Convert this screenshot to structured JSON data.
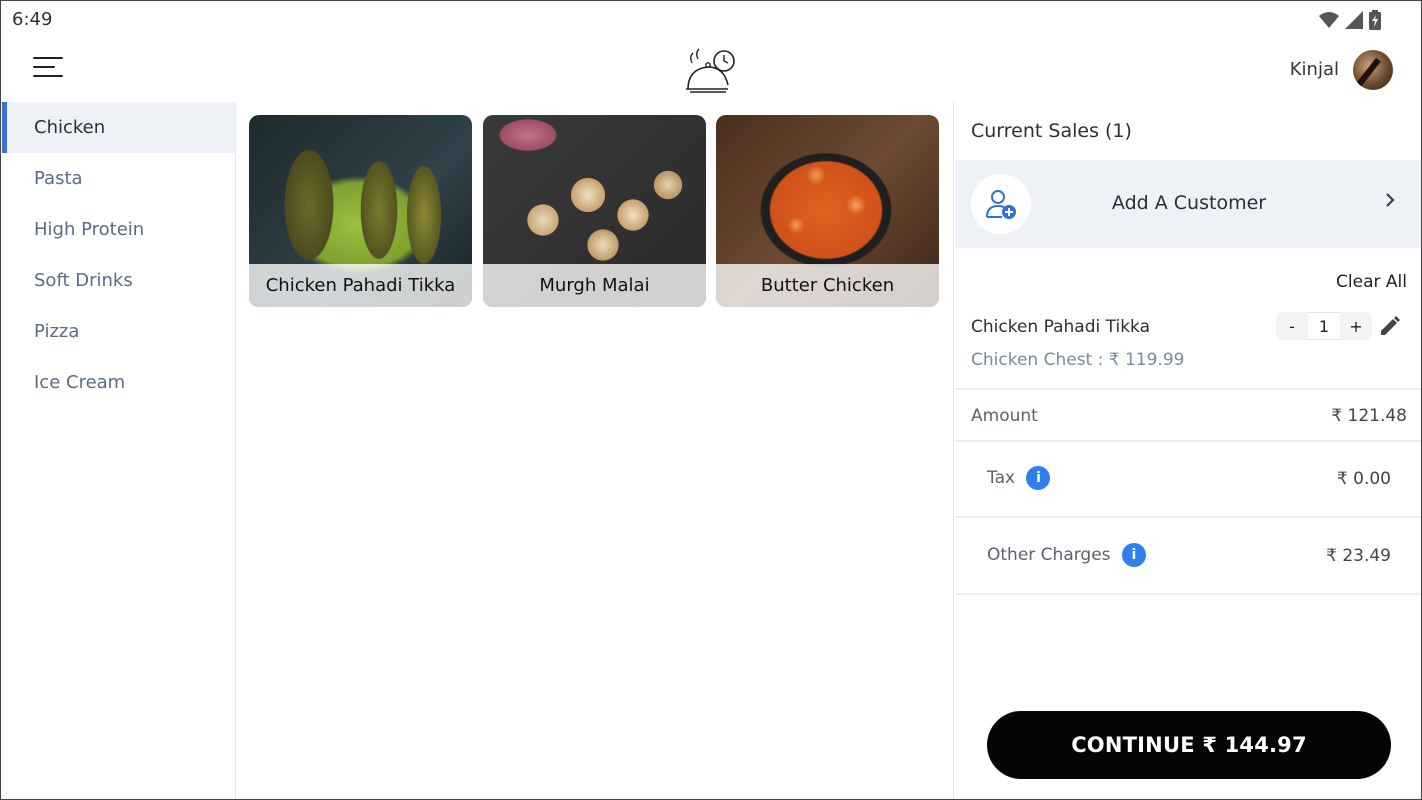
{
  "status_bar": {
    "time": "6:49",
    "icons": [
      "wifi-icon",
      "signal-icon",
      "battery-icon"
    ]
  },
  "header": {
    "menu_icon": "hamburger-menu-icon",
    "logo_icon": "food-cloche-clock-logo",
    "user_name": "Kinjal"
  },
  "categories": [
    {
      "label": "Chicken",
      "active": true
    },
    {
      "label": "Pasta"
    },
    {
      "label": "High Protein"
    },
    {
      "label": "Soft Drinks"
    },
    {
      "label": "Pizza"
    },
    {
      "label": "Ice Cream"
    }
  ],
  "products": [
    {
      "name": "Chicken Pahadi Tikka"
    },
    {
      "name": "Murgh Malai"
    },
    {
      "name": "Butter Chicken"
    }
  ],
  "sales": {
    "title": "Current Sales (1)",
    "add_customer_label": "Add A Customer",
    "clear_all": "Clear All",
    "line_item": {
      "name": "Chicken Pahadi Tikka",
      "variant": "Chicken Chest  :  ₹ 119.99",
      "minus": "-",
      "qty": "1",
      "plus": "+"
    },
    "amount_label": "Amount",
    "amount_value": "₹ 121.48",
    "tax_label": "Tax",
    "tax_value": "₹ 0.00",
    "other_label": "Other Charges",
    "other_value": "₹ 23.49",
    "info_glyph": "i",
    "continue_label": "CONTINUE ₹ 144.97"
  },
  "colors": {
    "accent": "#3a6fd8",
    "info": "#2f80ed",
    "button": "#050505",
    "highlight": "#eef1f6"
  }
}
